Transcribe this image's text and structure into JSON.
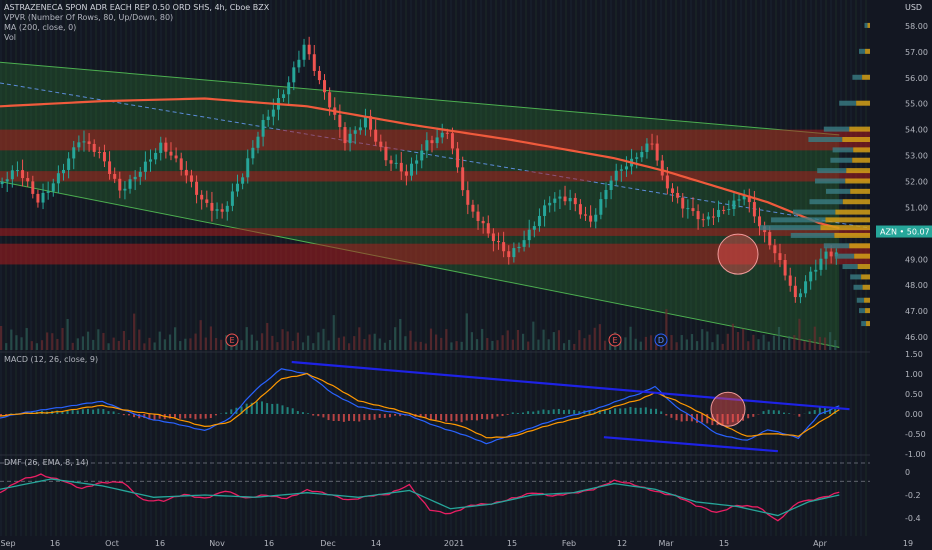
{
  "header": {
    "title": "ASTRAZENECA SPON ADR EACH REP 0.50 ORD SHS, 4h, Cboe BZX",
    "indicators": [
      "VPVR (Number Of Rows, 80, Up/Down, 80)",
      "MA (200, close, 0)",
      "Vol"
    ],
    "currency": "USD"
  },
  "colors": {
    "background": "#131722",
    "up": "#26a69a",
    "down": "#ef5350",
    "ma": "#f05a3c",
    "channel": "#2e7d32",
    "band": "#b71c1c",
    "trendline": "#1e22e6",
    "macd": "#2962ff",
    "signal": "#ff9800",
    "dmf": "#e91e63",
    "dmf_ema": "#26a69a",
    "price_tag": "#26a69a"
  },
  "chart_data": [
    {
      "type": "line",
      "panel": "price",
      "symbol": "AZN",
      "last_price": "50.07",
      "ylim": [
        45.5,
        59
      ],
      "yticks": [
        "58.00",
        "57.00",
        "56.00",
        "55.00",
        "54.00",
        "53.00",
        "52.00",
        "51.00",
        "50.00",
        "49.00",
        "48.00",
        "47.00",
        "46.00"
      ],
      "xticks": [
        "Sep",
        "16",
        "Oct",
        "16",
        "Nov",
        "16",
        "Dec",
        "14",
        "2021",
        "15",
        "Feb",
        "12",
        "Mar",
        "15",
        "Apr",
        "19"
      ],
      "events": [
        "E",
        "E",
        "D"
      ],
      "series": [
        {
          "role": "close",
          "points": [
            [
              0,
              51.9
            ],
            [
              4,
              52.3
            ],
            [
              8,
              51.2
            ],
            [
              12,
              52.4
            ],
            [
              16,
              53.6
            ],
            [
              20,
              52.9
            ],
            [
              24,
              51.7
            ],
            [
              28,
              52.6
            ],
            [
              32,
              53.3
            ],
            [
              36,
              52.4
            ],
            [
              40,
              51.4
            ],
            [
              44,
              50.9
            ],
            [
              48,
              52.1
            ],
            [
              52,
              54.2
            ],
            [
              56,
              55.6
            ],
            [
              60,
              57.3
            ],
            [
              64,
              55.2
            ],
            [
              68,
              53.6
            ],
            [
              72,
              54.6
            ],
            [
              76,
              52.8
            ],
            [
              80,
              52.1
            ],
            [
              84,
              53.6
            ],
            [
              88,
              54.1
            ],
            [
              92,
              50.9
            ],
            [
              96,
              49.9
            ],
            [
              100,
              49.3
            ],
            [
              104,
              50.1
            ],
            [
              108,
              51.1
            ],
            [
              112,
              51.3
            ],
            [
              116,
              50.6
            ],
            [
              120,
              52.1
            ],
            [
              124,
              52.6
            ],
            [
              128,
              53.6
            ],
            [
              130,
              52.3
            ],
            [
              134,
              51.1
            ],
            [
              138,
              50.3
            ],
            [
              142,
              50.9
            ],
            [
              146,
              51.7
            ],
            [
              150,
              49.9
            ],
            [
              154,
              48.3
            ],
            [
              156,
              47.4
            ],
            [
              159,
              48.6
            ],
            [
              162,
              49.4
            ],
            [
              164,
              49.2
            ]
          ]
        },
        {
          "role": "ma200",
          "name": "MA (200, close, 0)",
          "points": [
            [
              0,
              54.9
            ],
            [
              20,
              55.1
            ],
            [
              40,
              55.2
            ],
            [
              60,
              54.9
            ],
            [
              80,
              54.2
            ],
            [
              100,
              53.6
            ],
            [
              120,
              52.9
            ],
            [
              130,
              52.4
            ],
            [
              140,
              51.8
            ],
            [
              150,
              51.2
            ],
            [
              160,
              50.4
            ],
            [
              164,
              50.2
            ]
          ]
        }
      ],
      "channel": {
        "upper": [
          [
            0,
            56.6
          ],
          [
            164,
            53.8
          ]
        ],
        "lower": [
          [
            0,
            52.0
          ],
          [
            164,
            45.6
          ]
        ]
      },
      "bands": [
        [
          53.2,
          54.0
        ],
        [
          52.0,
          52.4
        ],
        [
          49.9,
          50.2
        ],
        [
          48.8,
          49.6
        ]
      ],
      "vpvr_rows": [
        [
          58.0,
          0.05
        ],
        [
          57.0,
          0.1
        ],
        [
          56.0,
          0.16
        ],
        [
          55.0,
          0.28
        ],
        [
          54.0,
          0.42
        ],
        [
          53.6,
          0.56
        ],
        [
          53.2,
          0.34
        ],
        [
          52.8,
          0.36
        ],
        [
          52.4,
          0.48
        ],
        [
          52.0,
          0.5
        ],
        [
          51.6,
          0.4
        ],
        [
          51.2,
          0.55
        ],
        [
          50.8,
          0.7
        ],
        [
          50.5,
          0.9
        ],
        [
          50.2,
          1.0
        ],
        [
          49.9,
          0.72
        ],
        [
          49.5,
          0.42
        ],
        [
          49.1,
          0.32
        ],
        [
          48.7,
          0.25
        ],
        [
          48.3,
          0.18
        ],
        [
          47.9,
          0.15
        ],
        [
          47.4,
          0.12
        ],
        [
          47.0,
          0.1
        ],
        [
          46.5,
          0.08
        ]
      ]
    },
    {
      "type": "line",
      "panel": "macd",
      "title": "MACD (12, 26, close, 9)",
      "ylim": [
        -0.95,
        1.55
      ],
      "yticks": [
        "1.50",
        "1.00",
        "0.50",
        "0.00",
        "-0.50",
        "-1.00"
      ],
      "series": [
        {
          "role": "macd",
          "points": [
            [
              0,
              -0.1
            ],
            [
              10,
              0.15
            ],
            [
              20,
              0.3
            ],
            [
              30,
              -0.15
            ],
            [
              40,
              -0.4
            ],
            [
              45,
              -0.1
            ],
            [
              50,
              0.6
            ],
            [
              55,
              1.15
            ],
            [
              60,
              1.0
            ],
            [
              65,
              0.5
            ],
            [
              70,
              0.2
            ],
            [
              80,
              -0.05
            ],
            [
              90,
              -0.5
            ],
            [
              95,
              -0.75
            ],
            [
              100,
              -0.5
            ],
            [
              110,
              -0.1
            ],
            [
              118,
              0.2
            ],
            [
              125,
              0.5
            ],
            [
              128,
              0.7
            ],
            [
              132,
              0.2
            ],
            [
              140,
              -0.5
            ],
            [
              146,
              -0.65
            ],
            [
              150,
              -0.4
            ],
            [
              156,
              -0.6
            ],
            [
              160,
              0.0
            ],
            [
              164,
              0.2
            ]
          ]
        },
        {
          "role": "signal",
          "points": [
            [
              0,
              -0.05
            ],
            [
              10,
              0.05
            ],
            [
              20,
              0.2
            ],
            [
              30,
              0.0
            ],
            [
              40,
              -0.3
            ],
            [
              45,
              -0.2
            ],
            [
              50,
              0.3
            ],
            [
              55,
              0.9
            ],
            [
              60,
              1.0
            ],
            [
              65,
              0.7
            ],
            [
              70,
              0.35
            ],
            [
              80,
              0.0
            ],
            [
              90,
              -0.3
            ],
            [
              95,
              -0.6
            ],
            [
              100,
              -0.55
            ],
            [
              110,
              -0.2
            ],
            [
              118,
              0.1
            ],
            [
              125,
              0.35
            ],
            [
              128,
              0.55
            ],
            [
              132,
              0.35
            ],
            [
              140,
              -0.2
            ],
            [
              146,
              -0.55
            ],
            [
              150,
              -0.5
            ],
            [
              156,
              -0.55
            ],
            [
              160,
              -0.2
            ],
            [
              164,
              0.1
            ]
          ]
        }
      ],
      "trendlines": [
        [
          [
            57,
            1.3
          ],
          [
            166,
            0.12
          ]
        ],
        [
          [
            118,
            -0.58
          ],
          [
            152,
            -0.93
          ]
        ]
      ]
    },
    {
      "type": "line",
      "panel": "dmf",
      "title": "DMF (26, EMA, 8, 14)",
      "ylim": [
        -0.55,
        0.15
      ],
      "yticks": [
        "0",
        "-0.2",
        "-0.4"
      ],
      "series": [
        {
          "role": "dmf",
          "points": [
            [
              0,
              -0.18
            ],
            [
              4,
              -0.08
            ],
            [
              8,
              -0.02
            ],
            [
              12,
              -0.06
            ],
            [
              16,
              -0.15
            ],
            [
              20,
              -0.1
            ],
            [
              24,
              -0.08
            ],
            [
              28,
              -0.24
            ],
            [
              32,
              -0.26
            ],
            [
              36,
              -0.2
            ],
            [
              40,
              -0.22
            ],
            [
              44,
              -0.16
            ],
            [
              48,
              -0.24
            ],
            [
              52,
              -0.2
            ],
            [
              56,
              -0.22
            ],
            [
              60,
              -0.16
            ],
            [
              64,
              -0.2
            ],
            [
              68,
              -0.24
            ],
            [
              72,
              -0.2
            ],
            [
              76,
              -0.2
            ],
            [
              80,
              -0.12
            ],
            [
              84,
              -0.32
            ],
            [
              88,
              -0.36
            ],
            [
              92,
              -0.3
            ],
            [
              96,
              -0.28
            ],
            [
              100,
              -0.22
            ],
            [
              104,
              -0.18
            ],
            [
              108,
              -0.22
            ],
            [
              112,
              -0.18
            ],
            [
              116,
              -0.14
            ],
            [
              120,
              -0.08
            ],
            [
              124,
              -0.12
            ],
            [
              128,
              -0.16
            ],
            [
              132,
              -0.2
            ],
            [
              136,
              -0.3
            ],
            [
              140,
              -0.36
            ],
            [
              144,
              -0.28
            ],
            [
              148,
              -0.3
            ],
            [
              152,
              -0.44
            ],
            [
              156,
              -0.26
            ],
            [
              160,
              -0.22
            ],
            [
              164,
              -0.18
            ]
          ]
        },
        {
          "role": "ema",
          "points": [
            [
              0,
              -0.15
            ],
            [
              10,
              -0.06
            ],
            [
              20,
              -0.12
            ],
            [
              30,
              -0.22
            ],
            [
              40,
              -0.2
            ],
            [
              50,
              -0.22
            ],
            [
              60,
              -0.18
            ],
            [
              70,
              -0.22
            ],
            [
              80,
              -0.16
            ],
            [
              88,
              -0.32
            ],
            [
              96,
              -0.28
            ],
            [
              104,
              -0.2
            ],
            [
              112,
              -0.18
            ],
            [
              120,
              -0.1
            ],
            [
              128,
              -0.15
            ],
            [
              136,
              -0.26
            ],
            [
              144,
              -0.3
            ],
            [
              152,
              -0.38
            ],
            [
              158,
              -0.26
            ],
            [
              164,
              -0.2
            ]
          ]
        }
      ]
    }
  ]
}
